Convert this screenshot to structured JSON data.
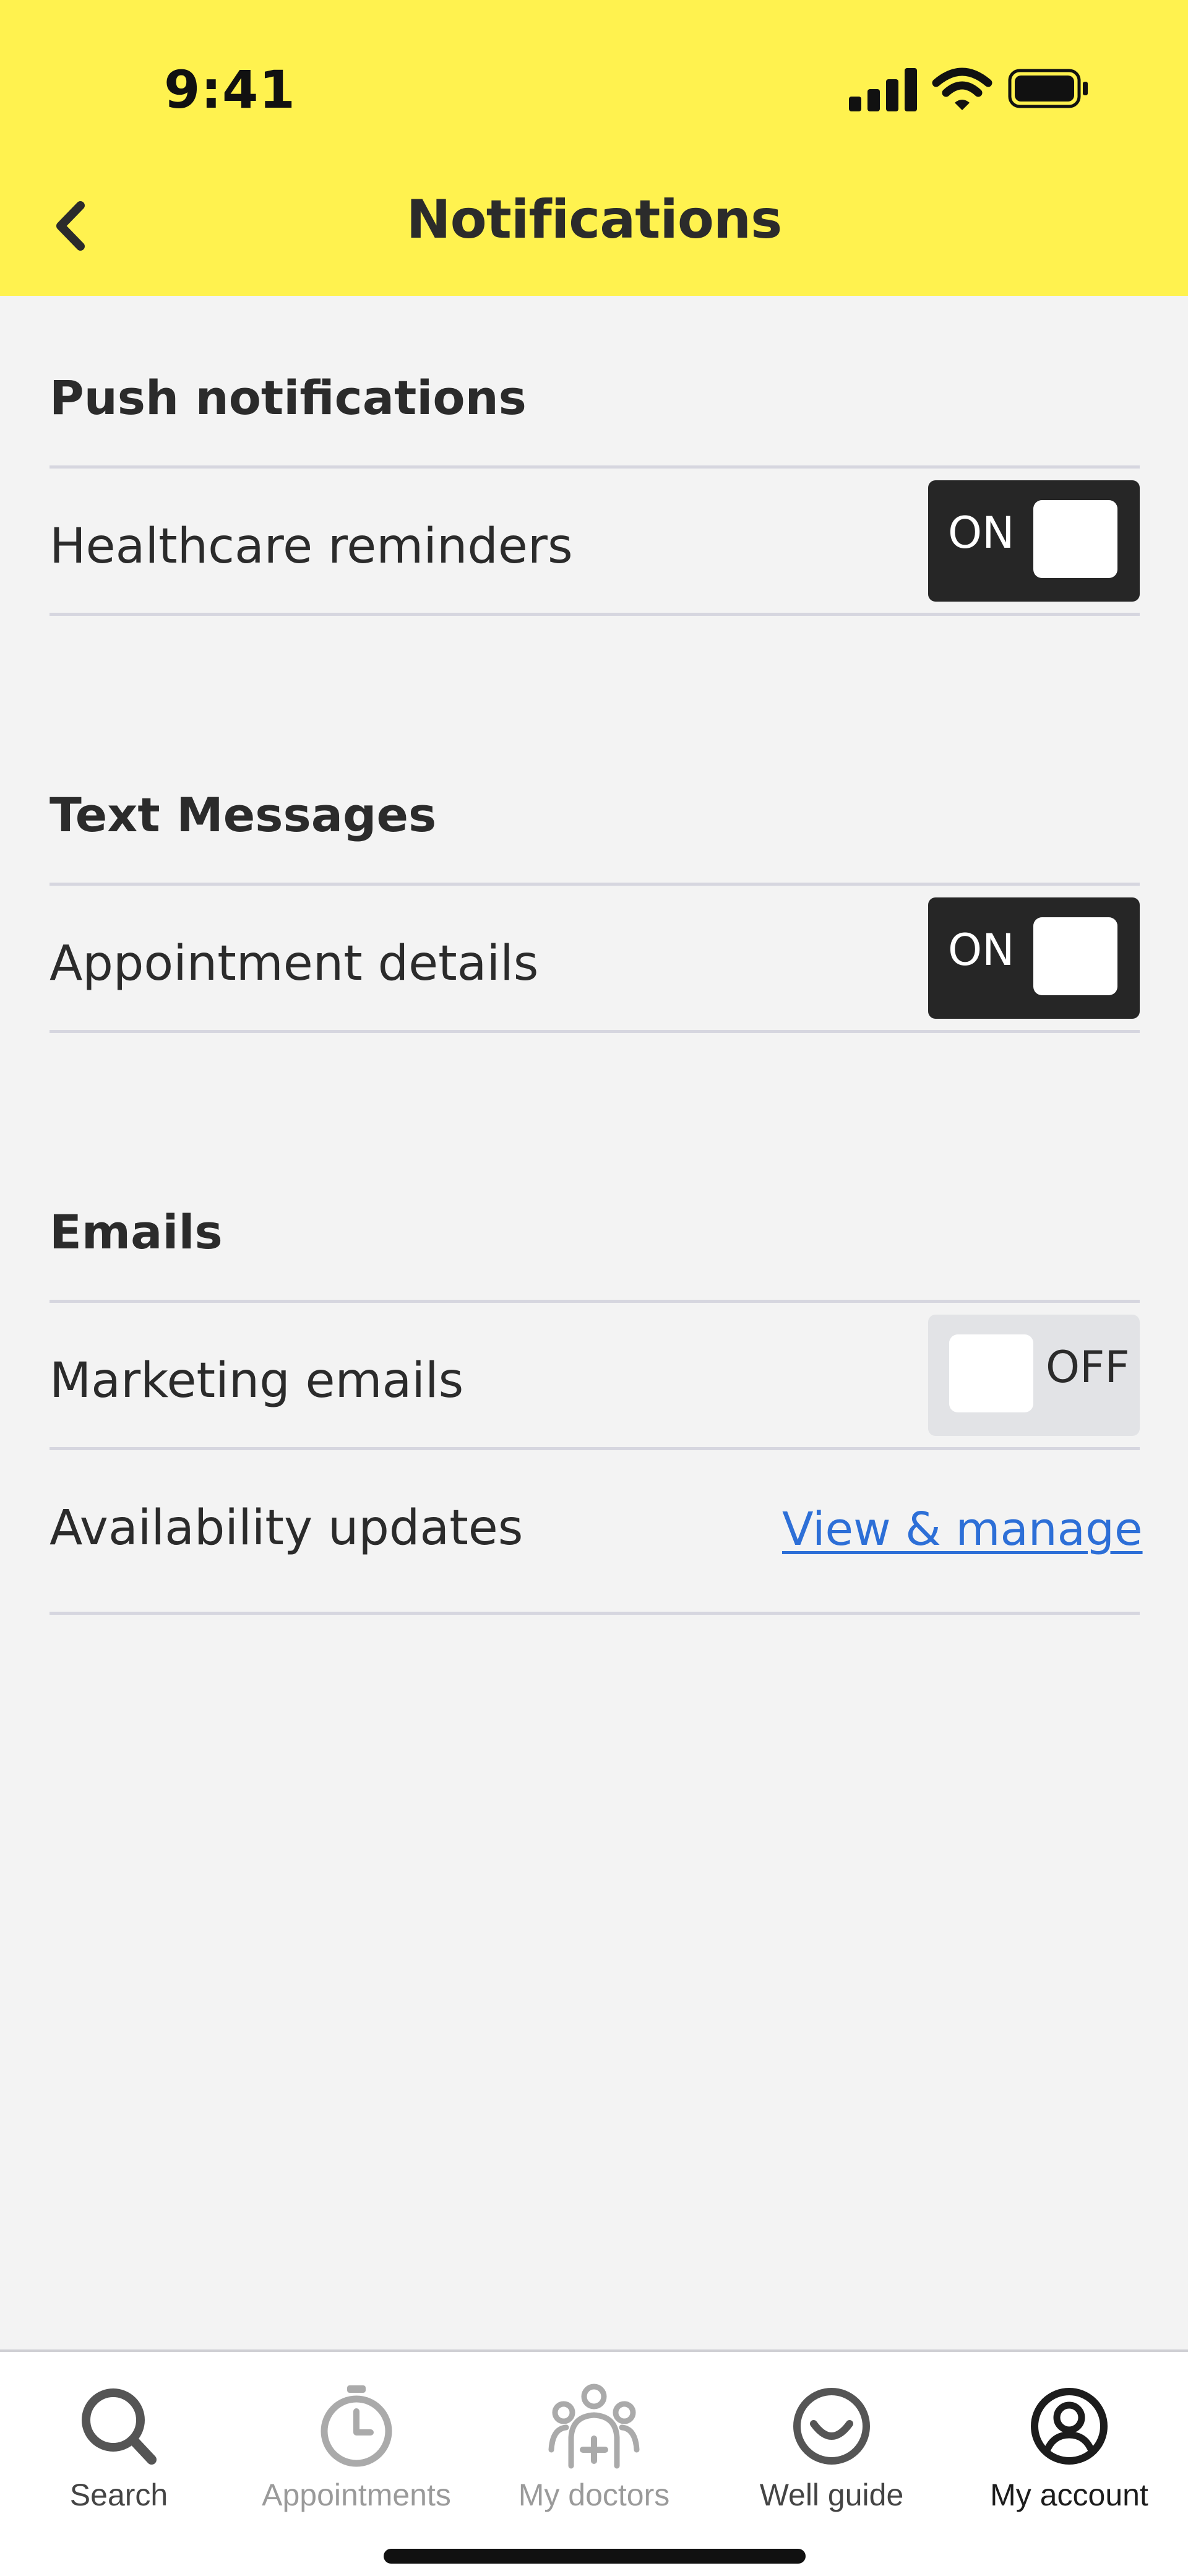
{
  "status_bar": {
    "time": "9:41"
  },
  "header": {
    "title": "Notifications",
    "back_icon": "chevron-left-icon",
    "background": "#fff24f"
  },
  "sections": {
    "push": {
      "title": "Push notifications",
      "rows": [
        {
          "label": "Healthcare reminders",
          "toggle": "ON",
          "enabled": true
        }
      ]
    },
    "text": {
      "title": "Text Messages",
      "rows": [
        {
          "label": "Appointment details",
          "toggle": "ON",
          "enabled": true
        }
      ]
    },
    "emails": {
      "title": "Emails",
      "rows": [
        {
          "label": "Marketing emails",
          "toggle": "OFF",
          "enabled": false
        },
        {
          "label": "Availability updates",
          "link": "View & manage"
        }
      ]
    }
  },
  "tabbar": {
    "tabs": [
      {
        "label": "Search",
        "icon": "search-icon"
      },
      {
        "label": "Appointments",
        "icon": "clock-icon"
      },
      {
        "label": "My doctors",
        "icon": "doctors-icon"
      },
      {
        "label": "Well guide",
        "icon": "smile-icon"
      },
      {
        "label": "My account",
        "icon": "account-icon"
      }
    ],
    "active": "My account"
  },
  "colors": {
    "accent_yellow": "#fff24f",
    "toggle_on": "#262626",
    "toggle_off": "#e2e3e6",
    "link": "#2d6fd7"
  }
}
